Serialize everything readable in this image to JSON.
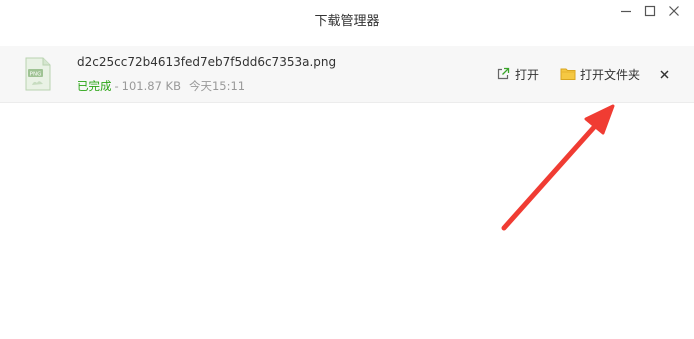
{
  "window": {
    "title": "下载管理器",
    "minimize_icon": "minimize-icon",
    "maximize_icon": "maximize-icon",
    "close_icon": "close-icon"
  },
  "download": {
    "file_name": "d2c25cc72b4613fed7eb7f5dd6c7353a.png",
    "file_icon": "png-file-icon",
    "file_icon_label": "PNG",
    "status": "已完成",
    "separator": "-",
    "size": "101.87 KB",
    "time": "今天15:11",
    "open_label": "打开",
    "open_icon": "open-file-icon",
    "open_folder_label": "打开文件夹",
    "folder_icon": "folder-icon",
    "remove_icon": "remove-icon"
  },
  "colors": {
    "status_done": "#2aa515",
    "row_background": "#f7f7f7",
    "folder_yellow": "#f5c842",
    "annotation_arrow": "#f03c33"
  }
}
